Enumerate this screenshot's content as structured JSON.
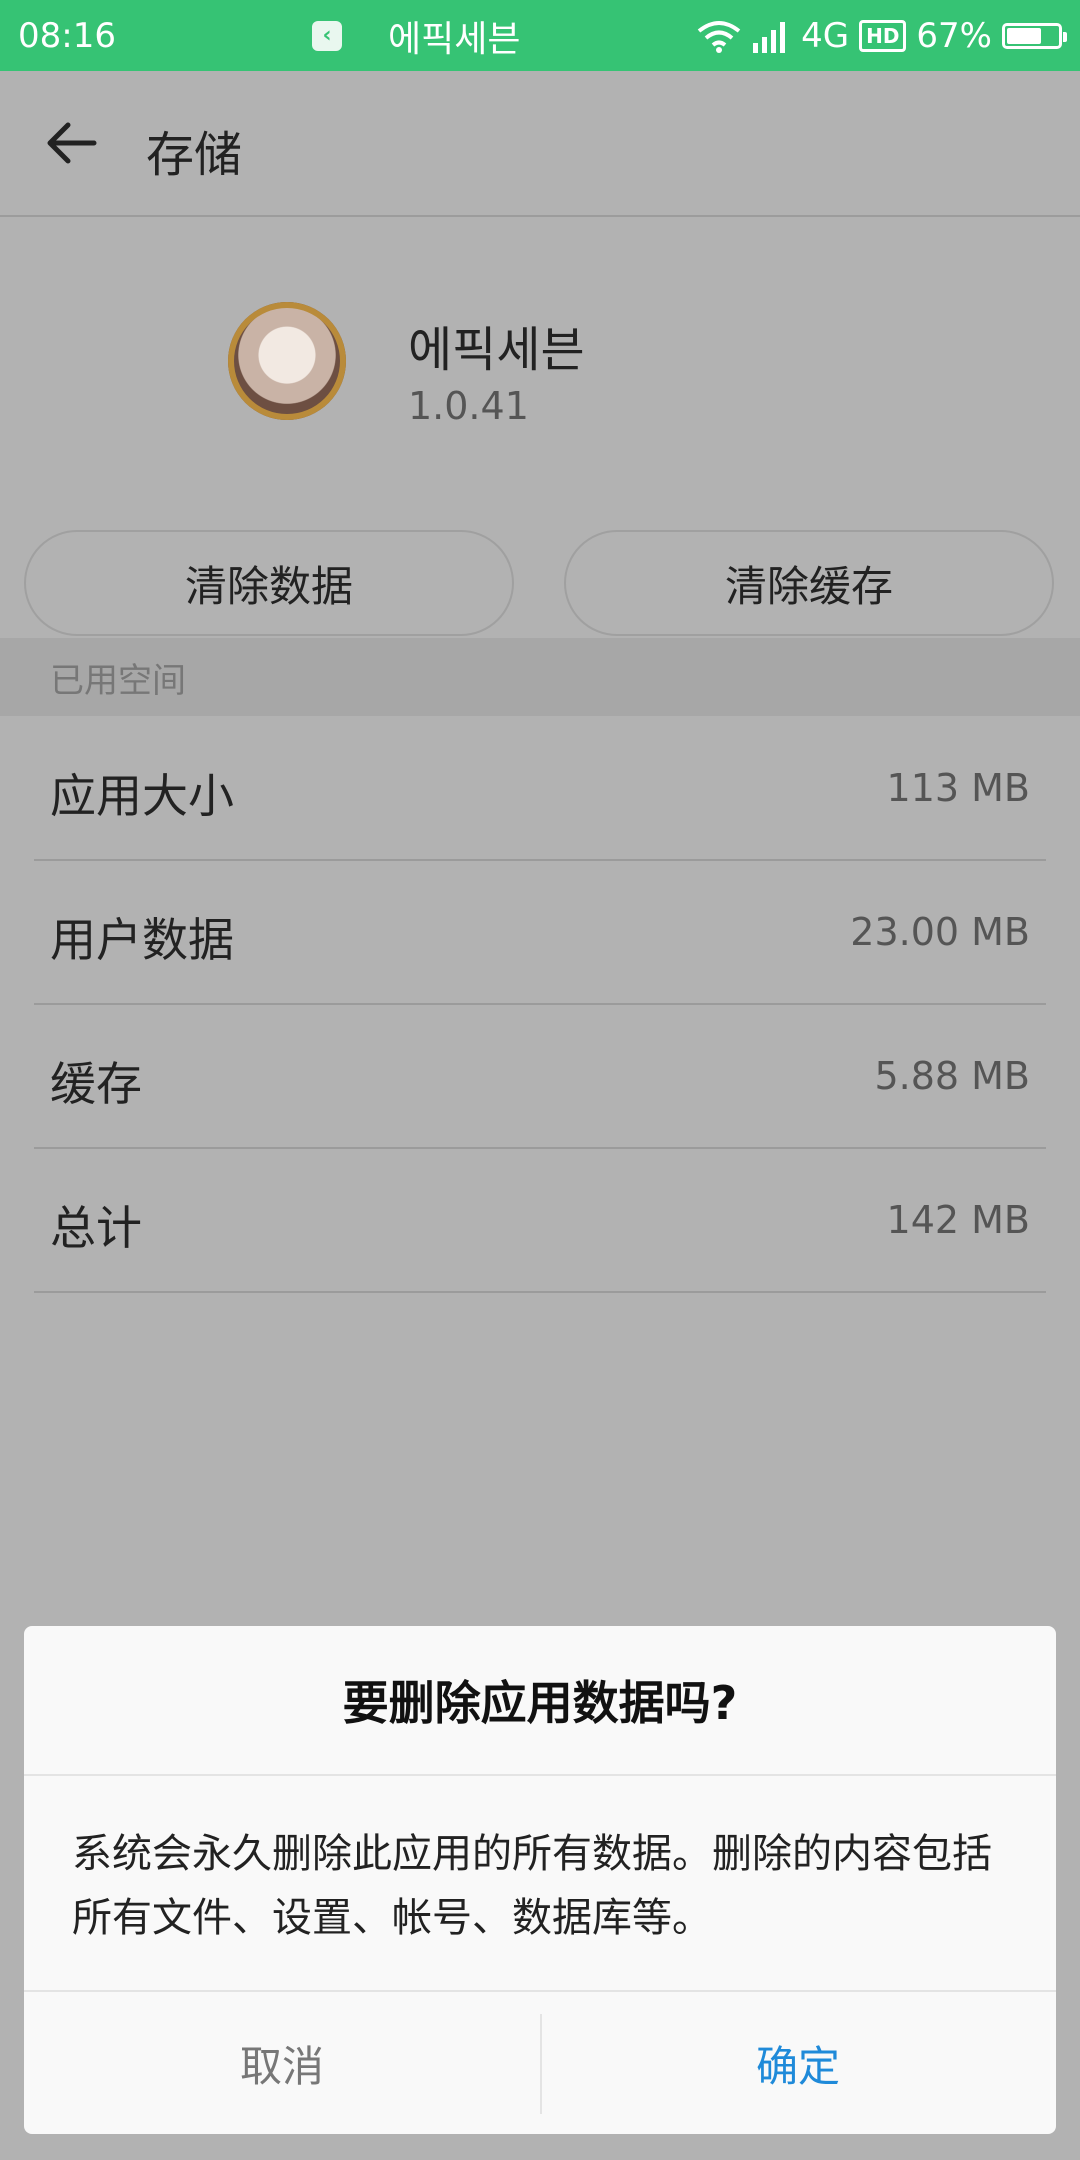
{
  "status_bar": {
    "time": "08:16",
    "app_label": "에픽세븐",
    "network": "4G",
    "hd": "HD",
    "battery_text": "67%",
    "battery_level": 0.67
  },
  "appbar": {
    "title": "存储"
  },
  "app": {
    "name": "에픽세븐",
    "version": "1.0.41"
  },
  "buttons": {
    "clear_data": "清除数据",
    "clear_cache": "清除缓存"
  },
  "section": {
    "header": "已用空间",
    "rows": [
      {
        "label": "应用大小",
        "value": "113 MB"
      },
      {
        "label": "用户数据",
        "value": "23.00 MB"
      },
      {
        "label": "缓存",
        "value": "5.88 MB"
      },
      {
        "label": "总计",
        "value": "142 MB"
      }
    ]
  },
  "dialog": {
    "title": "要删除应用数据吗?",
    "message": "系统会永久删除此应用的所有数据。删除的内容包括所有文件、设置、帐号、数据库等。",
    "cancel": "取消",
    "confirm": "确定"
  },
  "colors": {
    "status_bar": "#36c374",
    "accent": "#1f8ad9"
  }
}
